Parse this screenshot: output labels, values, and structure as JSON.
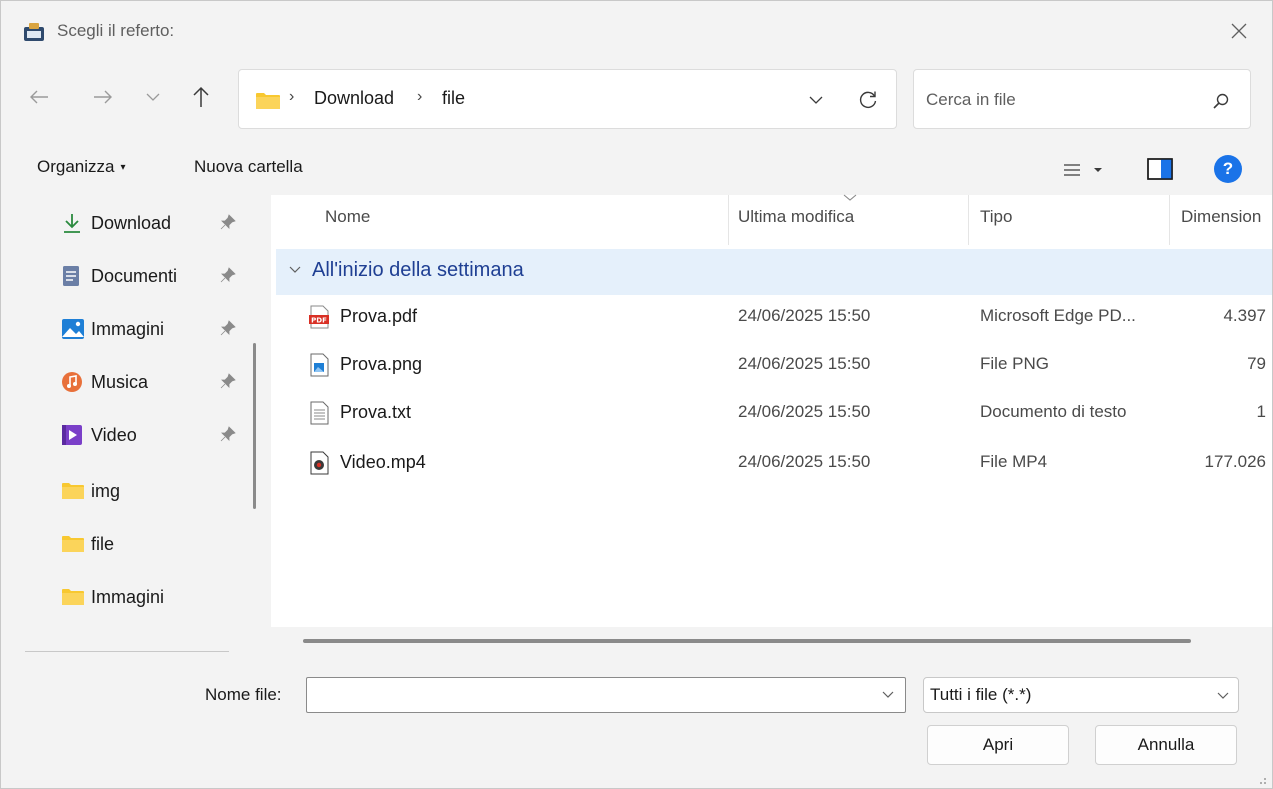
{
  "window": {
    "title": "Scegli il referto:"
  },
  "nav": {
    "back_icon": "arrow-left-icon",
    "forward_icon": "arrow-right-icon",
    "recent_icon": "chevron-down-icon",
    "up_icon": "arrow-up-icon"
  },
  "address": {
    "parts": [
      "Download",
      "file"
    ],
    "separator": "›"
  },
  "search": {
    "placeholder": "Cerca in file"
  },
  "toolbar": {
    "organize_label": "Organizza",
    "organize_caret": "▾",
    "new_folder_label": "Nuova cartella",
    "help_label": "?"
  },
  "sidebar": {
    "items": [
      {
        "label": "Download",
        "icon": "download-arrow-icon",
        "pinned": true
      },
      {
        "label": "Documenti",
        "icon": "documents-icon",
        "pinned": true
      },
      {
        "label": "Immagini",
        "icon": "pictures-icon",
        "pinned": true
      },
      {
        "label": "Musica",
        "icon": "music-icon",
        "pinned": true
      },
      {
        "label": "Video",
        "icon": "video-icon",
        "pinned": true
      },
      {
        "label": "img",
        "icon": "folder-icon",
        "pinned": false
      },
      {
        "label": "file",
        "icon": "folder-icon",
        "pinned": false
      },
      {
        "label": "Immagini",
        "icon": "folder-icon",
        "pinned": false
      }
    ]
  },
  "list": {
    "columns": {
      "name": "Nome",
      "modified": "Ultima modifica",
      "type": "Tipo",
      "size": "Dimension"
    },
    "group_label": "All'inizio della settimana",
    "files": [
      {
        "name": "Prova.pdf",
        "date": "24/06/2025 15:50",
        "type": "Microsoft Edge PD...",
        "size": "4.397",
        "icon": "pdf-file-icon"
      },
      {
        "name": "Prova.png",
        "date": "24/06/2025 15:50",
        "type": "File PNG",
        "size": "79",
        "icon": "image-file-icon"
      },
      {
        "name": "Prova.txt",
        "date": "24/06/2025 15:50",
        "type": "Documento di testo",
        "size": "1",
        "icon": "text-file-icon"
      },
      {
        "name": "Video.mp4",
        "date": "24/06/2025 15:50",
        "type": "File MP4",
        "size": "177.026",
        "icon": "video-file-icon"
      }
    ]
  },
  "bottom": {
    "filename_label": "Nome file:",
    "filename_value": "",
    "filter_value": "Tutti i file (*.*)",
    "open_label": "Apri",
    "cancel_label": "Annulla"
  },
  "colors": {
    "accent": "#1a73e8",
    "group_bg": "#e5f0fb",
    "group_text": "#1f3f93",
    "folder": "#f8c830",
    "pdf_red": "#d93025"
  }
}
